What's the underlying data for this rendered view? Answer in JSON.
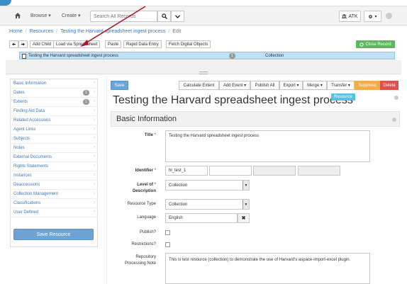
{
  "navbar": {
    "browse_label": "Browse ▾",
    "create_label": "Create ▾",
    "search_placeholder": "Search All Records",
    "user_label": "ATK"
  },
  "breadcrumb": {
    "home": "Home",
    "resources": "Resources",
    "record": "Testing the Harvard spreadsheet ingest process",
    "action": "Edit"
  },
  "toolbar": {
    "add_child": "Add Child",
    "load_spreadsheet": "Load via Spreadsheet",
    "paste": "Paste",
    "rapid_data_entry": "Rapid Data Entry",
    "fetch_digital_objects": "Fetch Digital Objects",
    "close_record": "Close Record"
  },
  "tree": {
    "title": "Testing the Harvard spreadsheet ingest process",
    "count": "1",
    "level": "Collection"
  },
  "sidebar": {
    "items": [
      {
        "label": "Basic Information",
        "count": ""
      },
      {
        "label": "Dates",
        "count": "1"
      },
      {
        "label": "Extents",
        "count": "1"
      },
      {
        "label": "Finding Aid Data",
        "count": ""
      },
      {
        "label": "Related Accessions",
        "count": ""
      },
      {
        "label": "Agent Links",
        "count": ""
      },
      {
        "label": "Subjects",
        "count": ""
      },
      {
        "label": "Notes",
        "count": ""
      },
      {
        "label": "External Documents",
        "count": ""
      },
      {
        "label": "Rights Statements",
        "count": ""
      },
      {
        "label": "Instances",
        "count": ""
      },
      {
        "label": "Deaccessions",
        "count": ""
      },
      {
        "label": "Collection Management",
        "count": ""
      },
      {
        "label": "Classifications",
        "count": ""
      },
      {
        "label": "User Defined",
        "count": ""
      }
    ],
    "save_label": "Save Resource"
  },
  "actions": {
    "save": "Save",
    "calculate_extent": "Calculate Extent",
    "add_event": "Add Event ▾",
    "publish_all": "Publish All",
    "export": "Export ▾",
    "merge": "Merge ▾",
    "transfer": "Transfer ▾",
    "suppress": "Suppress",
    "delete": "Delete"
  },
  "record": {
    "title": "Testing the Harvard spreadsheet ingest process",
    "type_badge": "Resource",
    "section_heading": "Basic Information"
  },
  "form": {
    "title_label": "Title",
    "title_value": "Testing the Harvard spreadsheet ingest process",
    "identifier_label": "Identifier",
    "identifier_value": "hl_test_1",
    "level_label_1": "Level of",
    "level_label_2": "Description",
    "level_value": "Collection",
    "resource_type_label": "Resource Type",
    "resource_type_value": "Collection",
    "language_label": "Language",
    "language_value": "English",
    "publish_label": "Publish?",
    "restrictions_label": "Restrictions?",
    "repo_note_label_1": "Repository",
    "repo_note_label_2": "Processing Note",
    "repo_note_value": "This is test resource (collection) to demonstrate the use of Harvard's aspace-import-excel plugin."
  },
  "colors": {
    "primary": "#6fa3d3",
    "success": "#5cb85c",
    "warning": "#f0ad4e",
    "danger": "#d9534f",
    "info": "#5bc0de",
    "tree_highlight": "#bfe0f5",
    "arrow": "#b0182a"
  }
}
